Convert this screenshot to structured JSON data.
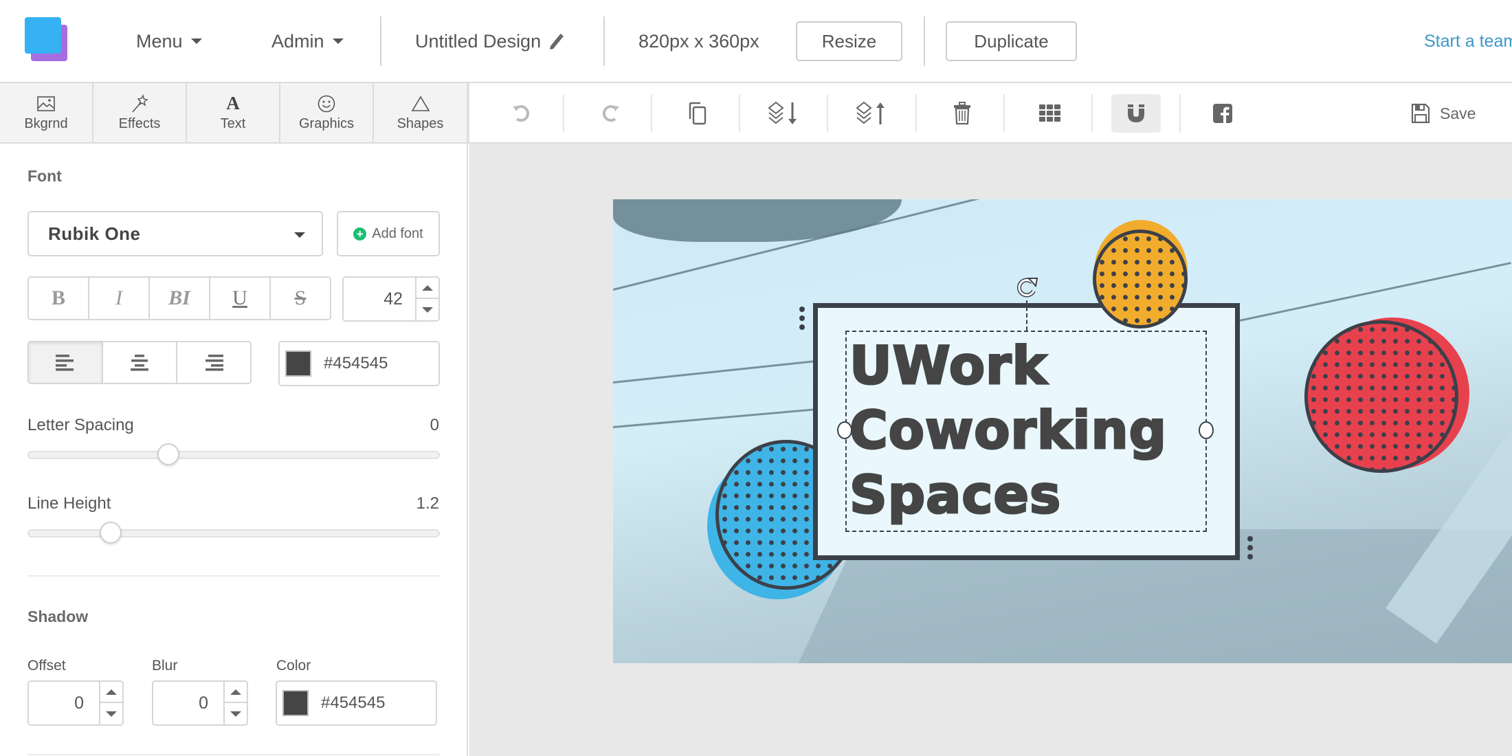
{
  "header": {
    "logo_colors": {
      "front": "#36b1f3",
      "back": "#a66ee0"
    },
    "menu_label": "Menu",
    "admin_label": "Admin",
    "design_title": "Untitled Design",
    "dimensions": "820px x 360px",
    "resize_label": "Resize",
    "duplicate_label": "Duplicate",
    "team_link": "Start a team"
  },
  "tabs": [
    {
      "label": "Bkgrnd",
      "icon": "image-icon"
    },
    {
      "label": "Effects",
      "icon": "magic-wand-icon"
    },
    {
      "label": "Text",
      "icon": "text-icon"
    },
    {
      "label": "Graphics",
      "icon": "smiley-icon"
    },
    {
      "label": "Shapes",
      "icon": "triangle-icon"
    }
  ],
  "toolbar": {
    "items": [
      "undo-icon",
      "redo-icon",
      "copy-icon",
      "send-backward-icon",
      "bring-forward-icon",
      "trash-icon",
      "grid-icon",
      "magnet-icon",
      "facebook-icon"
    ],
    "active": "magnet-icon",
    "save_label": "Save"
  },
  "sidebar": {
    "font": {
      "section_title": "Font",
      "selected_font": "Rubik One",
      "add_font_label": "Add font",
      "styles": [
        "B",
        "I",
        "BI",
        "U",
        "S"
      ],
      "size": "42",
      "alignments": [
        "align-left",
        "align-center",
        "align-right"
      ],
      "active_alignment": "align-left",
      "color_hex": "#454545"
    },
    "letter_spacing": {
      "label": "Letter Spacing",
      "value": "0",
      "fraction": 0.34
    },
    "line_height": {
      "label": "Line Height",
      "value": "1.2",
      "fraction": 0.2
    },
    "shadow": {
      "section_title": "Shadow",
      "offset_label": "Offset",
      "offset_value": "0",
      "blur_label": "Blur",
      "blur_value": "0",
      "color_label": "Color",
      "color_hex": "#454545"
    }
  },
  "canvas": {
    "title_lines": "UWork\nCoworking\nSpaces",
    "text_color": "#454545",
    "circle_colors": {
      "blue": "#3fb4e6",
      "yellow": "#f2ac2d",
      "red": "#e8414e"
    }
  }
}
